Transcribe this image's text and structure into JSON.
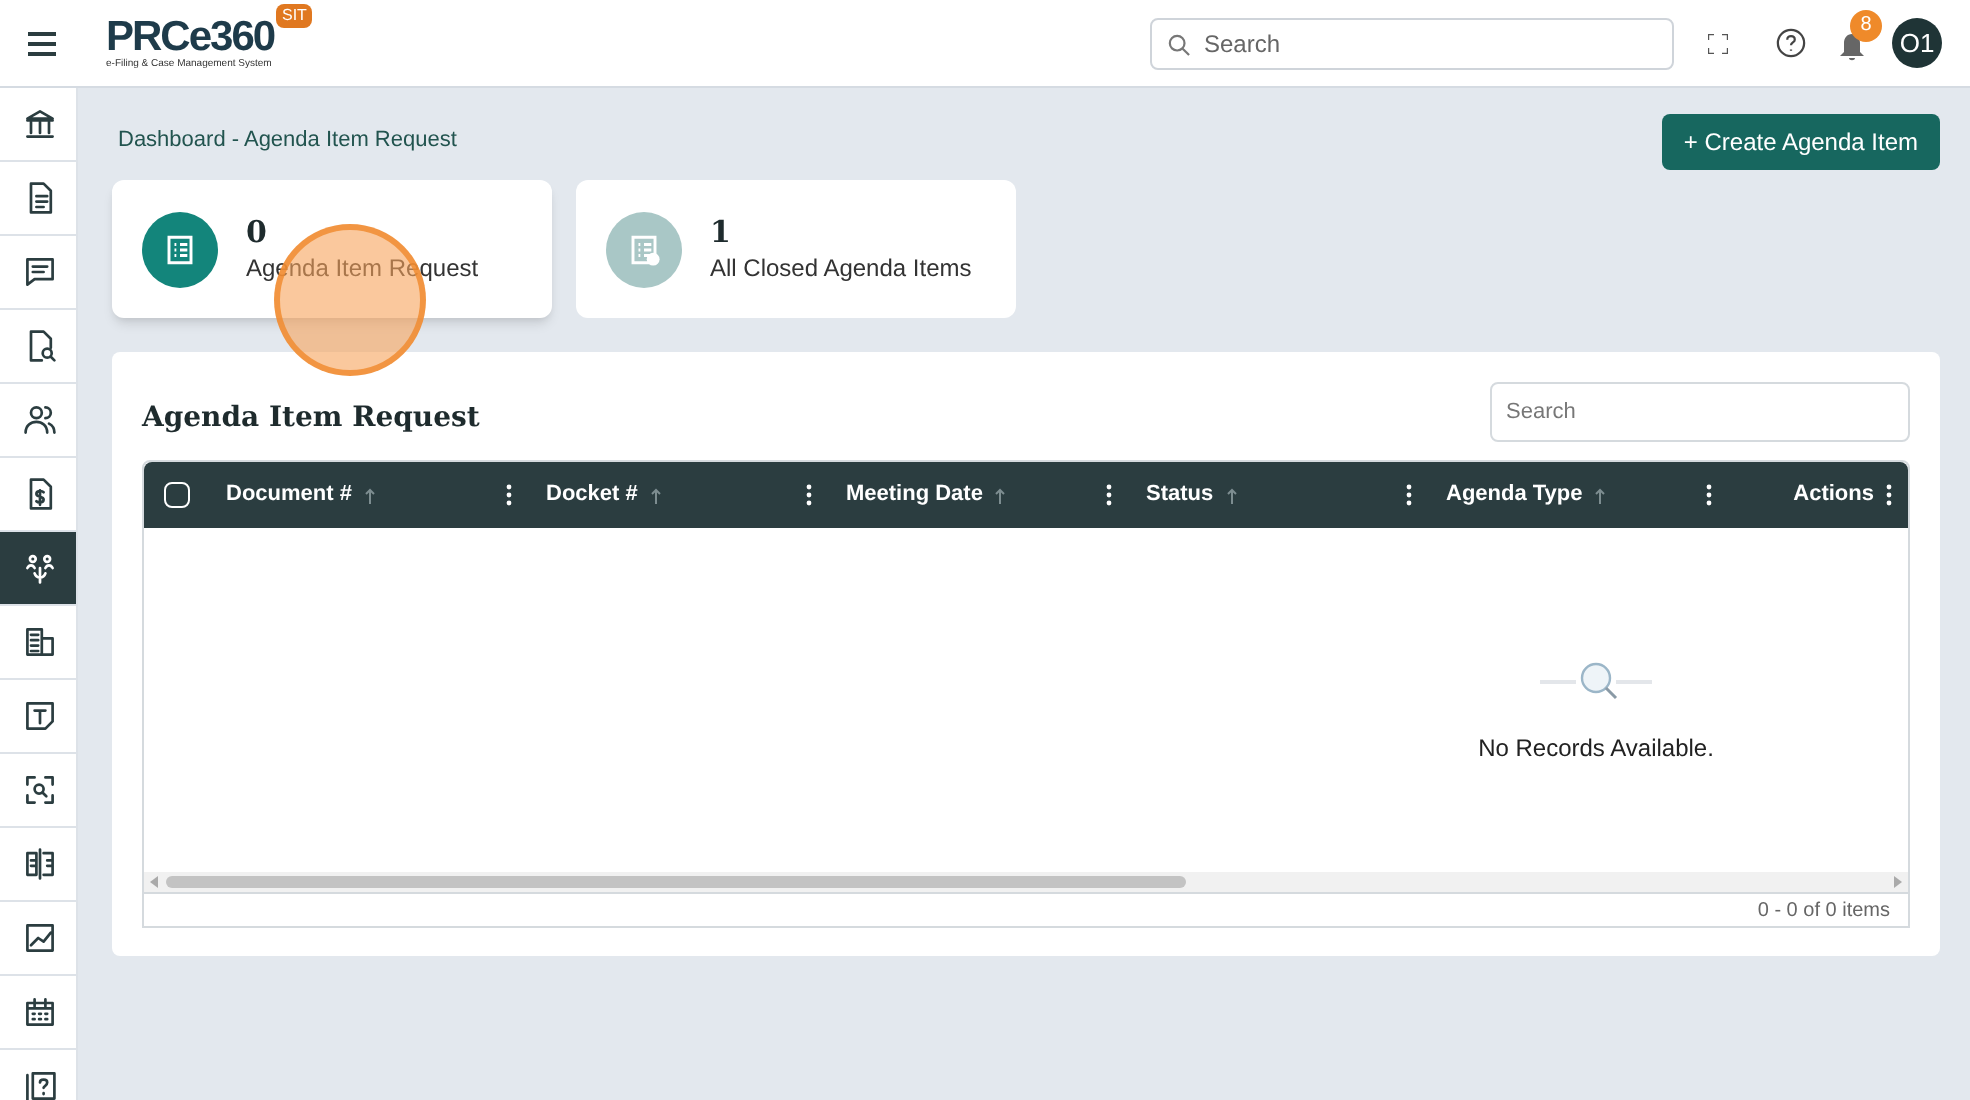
{
  "header": {
    "logo": "PRCe360",
    "logo_subtitle": "e-Filing & Case Management System",
    "environment_badge": "SIT",
    "search": {
      "placeholder": "Search"
    },
    "notifications_count": "8",
    "avatar": "O1"
  },
  "sidebar": {
    "items": [
      {
        "selected": false
      },
      {
        "selected": false
      },
      {
        "selected": false
      },
      {
        "selected": false
      },
      {
        "selected": false
      },
      {
        "selected": false
      },
      {
        "selected": true
      },
      {
        "selected": false
      },
      {
        "selected": false
      },
      {
        "selected": false
      },
      {
        "selected": false
      },
      {
        "selected": false
      },
      {
        "selected": false
      },
      {
        "selected": false
      }
    ]
  },
  "breadcrumb": "Dashboard - Agenda Item Request",
  "create_button": "+ Create Agenda Item",
  "summary_cards": [
    {
      "count": "0",
      "label": "Agenda Item Request",
      "selected": true
    },
    {
      "count": "1",
      "label": "All Closed Agenda Items",
      "selected": false
    }
  ],
  "panel": {
    "title": "Agenda Item Request",
    "search": {
      "placeholder": "Search"
    },
    "table": {
      "select_all_checked": false,
      "columns": [
        {
          "label": "Document #",
          "sortable": true
        },
        {
          "label": "Docket #",
          "sortable": true
        },
        {
          "label": "Meeting Date",
          "sortable": true
        },
        {
          "label": "Status",
          "sortable": true
        },
        {
          "label": "Agenda Type",
          "sortable": true
        },
        {
          "label": "Actions",
          "sortable": false
        }
      ],
      "empty_message": "No Records Available.",
      "pager": "0 - 0 of 0 items"
    }
  }
}
